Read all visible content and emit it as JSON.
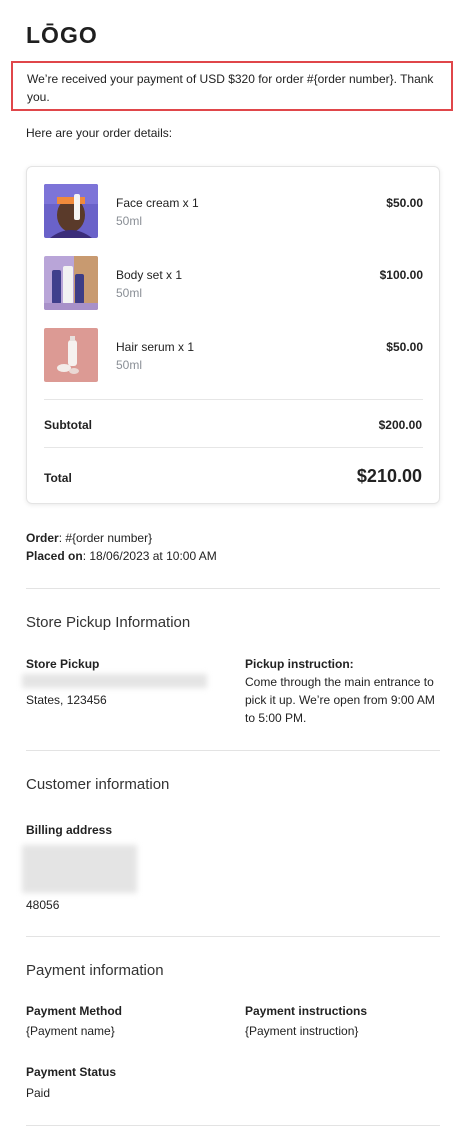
{
  "logo": "LŌGO",
  "alert": {
    "text": "We’re received your payment of USD $320 for order #{order number}. Thank you."
  },
  "intro": "Here are your order details:",
  "items": [
    {
      "name": "Face cream x 1",
      "variant": "50ml",
      "price": "$50.00",
      "image": "face-cream-photo"
    },
    {
      "name": "Body set x 1",
      "variant": "50ml",
      "price": "$100.00",
      "image": "body-set-photo"
    },
    {
      "name": "Hair serum x 1",
      "variant": "50ml",
      "price": "$50.00",
      "image": "hair-serum-photo"
    }
  ],
  "summary": {
    "subtotal_label": "Subtotal",
    "subtotal_value": "$200.00",
    "total_label": "Total",
    "total_value": "$210.00"
  },
  "order_meta": {
    "order_label": "Order",
    "order_value": ": #{order number}",
    "placed_label": "Placed on",
    "placed_value": ": 18/06/2023 at 10:00 AM"
  },
  "pickup": {
    "title": "Store Pickup Information",
    "store_label": "Store Pickup",
    "address_tail": "States, 123456",
    "instruction_label": "Pickup instruction:",
    "instruction_text": "Come through the main entrance to pick it up. We’re open from 9:00 AM to 5:00 PM."
  },
  "customer": {
    "title": "Customer information",
    "billing_label": "Billing address",
    "zip": "48056"
  },
  "payment": {
    "title": "Payment information",
    "method_label": "Payment Method",
    "method_value": "{Payment name}",
    "instructions_label": "Payment instructions",
    "instructions_value": "{Payment instruction}",
    "status_label": "Payment Status",
    "status_value": "Paid"
  },
  "colors": {
    "alert_border": "#e0464a",
    "muted_text": "#8a8f96",
    "divider": "#e6e6e6"
  }
}
